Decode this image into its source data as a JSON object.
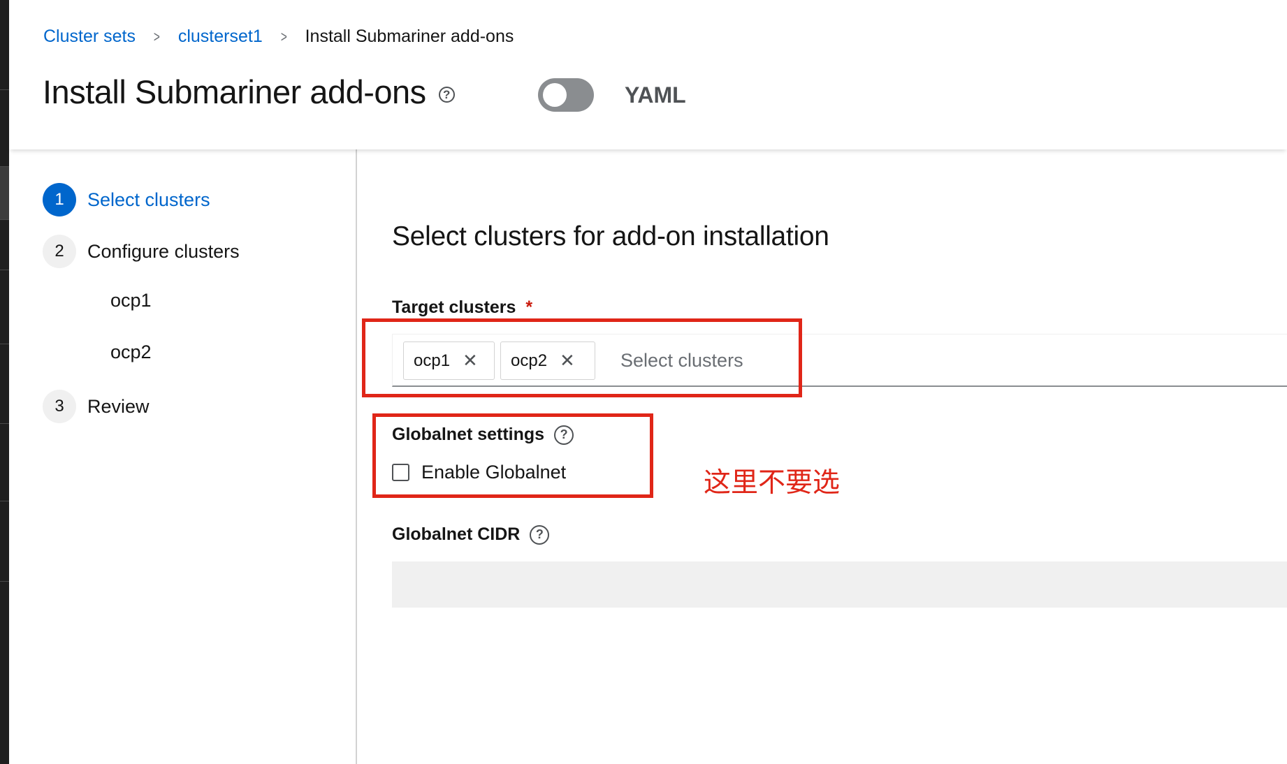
{
  "breadcrumb": {
    "item1": "Cluster sets",
    "item2": "clusterset1",
    "current": "Install Submariner add-ons",
    "separator": ">"
  },
  "header": {
    "title": "Install Submariner add-ons",
    "help_icon_glyph": "?",
    "yaml_label": "YAML",
    "yaml_toggle_on": false
  },
  "wizard": {
    "steps": [
      {
        "number": "1",
        "label": "Select clusters",
        "active": true
      },
      {
        "number": "2",
        "label": "Configure clusters",
        "active": false
      },
      {
        "number": "3",
        "label": "Review",
        "active": false
      }
    ],
    "substeps": [
      "ocp1",
      "ocp2"
    ]
  },
  "main": {
    "section_title": "Select clusters for add-on installation",
    "target_clusters": {
      "label": "Target clusters",
      "required_marker": "*",
      "chips": [
        {
          "label": "ocp1",
          "remove_glyph": "✕"
        },
        {
          "label": "ocp2",
          "remove_glyph": "✕"
        }
      ],
      "placeholder": "Select clusters"
    },
    "globalnet_settings": {
      "label": "Globalnet settings",
      "checkbox_label": "Enable Globalnet",
      "checked": false
    },
    "globalnet_cidr": {
      "label": "Globalnet CIDR",
      "value": ""
    }
  },
  "annotation": {
    "text": "这里不要选",
    "color": "#e02618"
  },
  "colors": {
    "link": "#0066cc",
    "required": "#c9190b",
    "toggle_off": "#8a8d90"
  },
  "icons": {
    "help": "question-circle-icon",
    "chip_remove": "times-icon",
    "breadcrumb_separator": "angle-right-icon"
  }
}
